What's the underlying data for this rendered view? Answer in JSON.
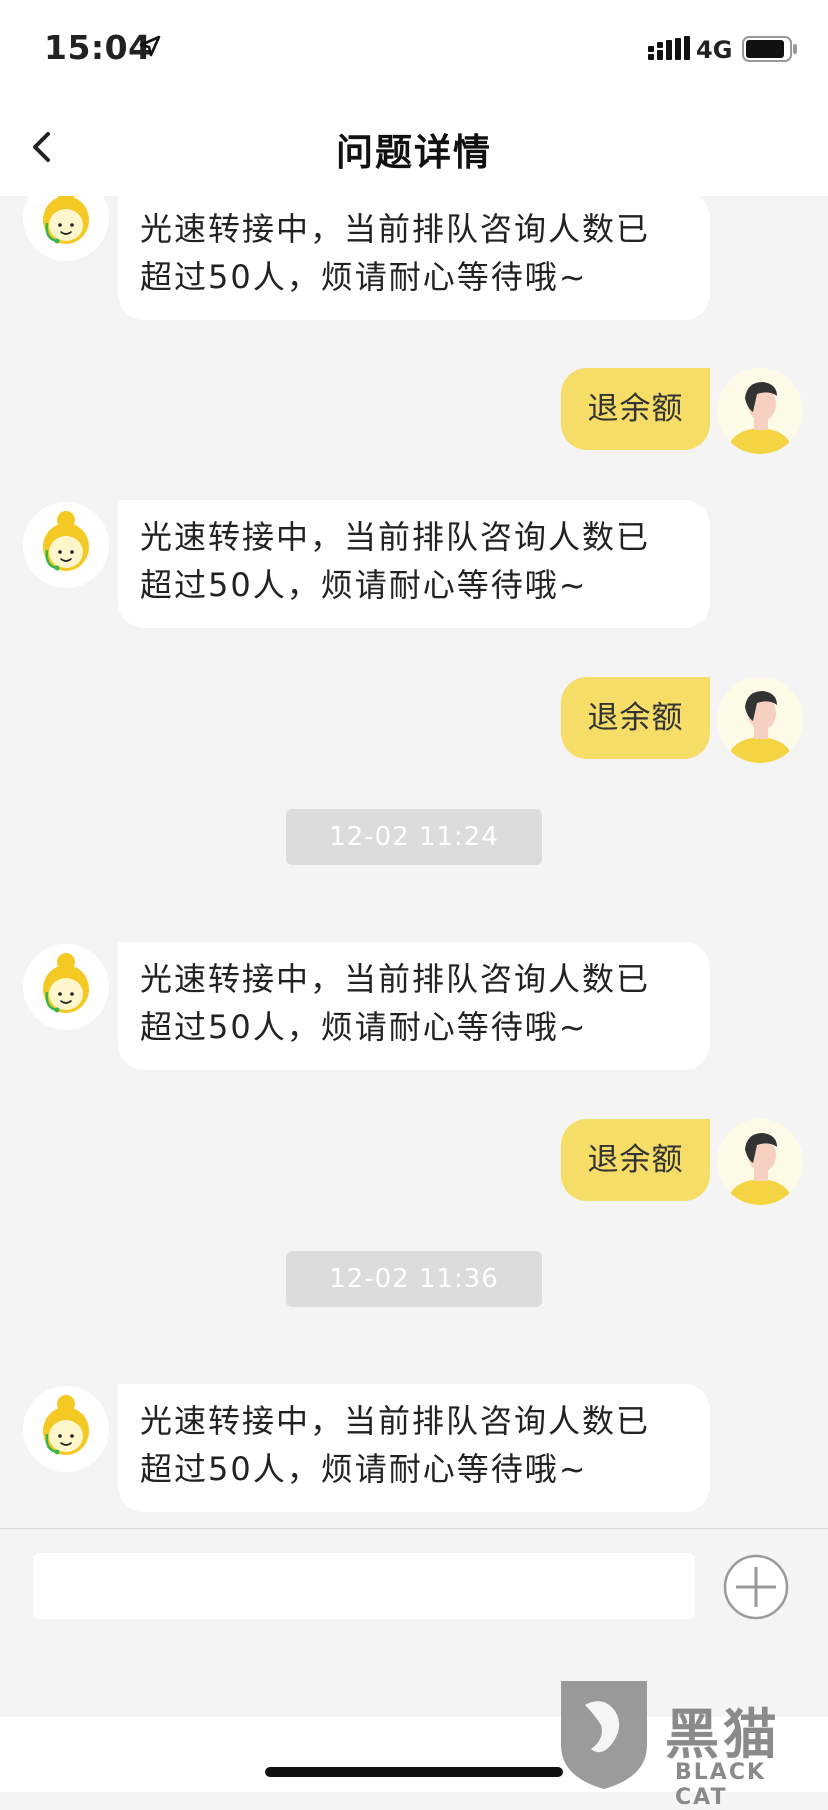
{
  "status_bar": {
    "time": "15:04",
    "network": "4G"
  },
  "nav": {
    "title": "问题详情"
  },
  "messages": [
    {
      "from": "agent",
      "text_line1": "光速转接中，当前排队咨询人数已",
      "text_line2": "超过50人，烦请耐心等待哦~"
    },
    {
      "from": "user",
      "text": "退余额"
    },
    {
      "from": "agent",
      "text_line1": "光速转接中，当前排队咨询人数已",
      "text_line2": "超过50人，烦请耐心等待哦~"
    },
    {
      "from": "user",
      "text": "退余额"
    },
    {
      "from": "timestamp",
      "text": "12-02 11:24"
    },
    {
      "from": "agent",
      "text_line1": "光速转接中，当前排队咨询人数已",
      "text_line2": "超过50人，烦请耐心等待哦~"
    },
    {
      "from": "user",
      "text": "退余额"
    },
    {
      "from": "timestamp",
      "text": "12-02 11:36"
    },
    {
      "from": "agent",
      "text_line1": "光速转接中，当前排队咨询人数已",
      "text_line2": "超过50人，烦请耐心等待哦~"
    }
  ],
  "input": {
    "value": "",
    "placeholder": ""
  },
  "watermark": {
    "text": "黑猫",
    "sub": "BLACK CAT"
  },
  "colors": {
    "user_bubble": "#f5dd68",
    "agent_bubble": "#ffffff",
    "background": "#f4f4f4",
    "timestamp_bg": "#dcdcdc"
  },
  "icons": [
    "location-arrow-icon",
    "signal-icon",
    "battery-icon",
    "back-chevron-icon",
    "agent-avatar-icon",
    "user-avatar-icon",
    "plus-circle-icon"
  ]
}
